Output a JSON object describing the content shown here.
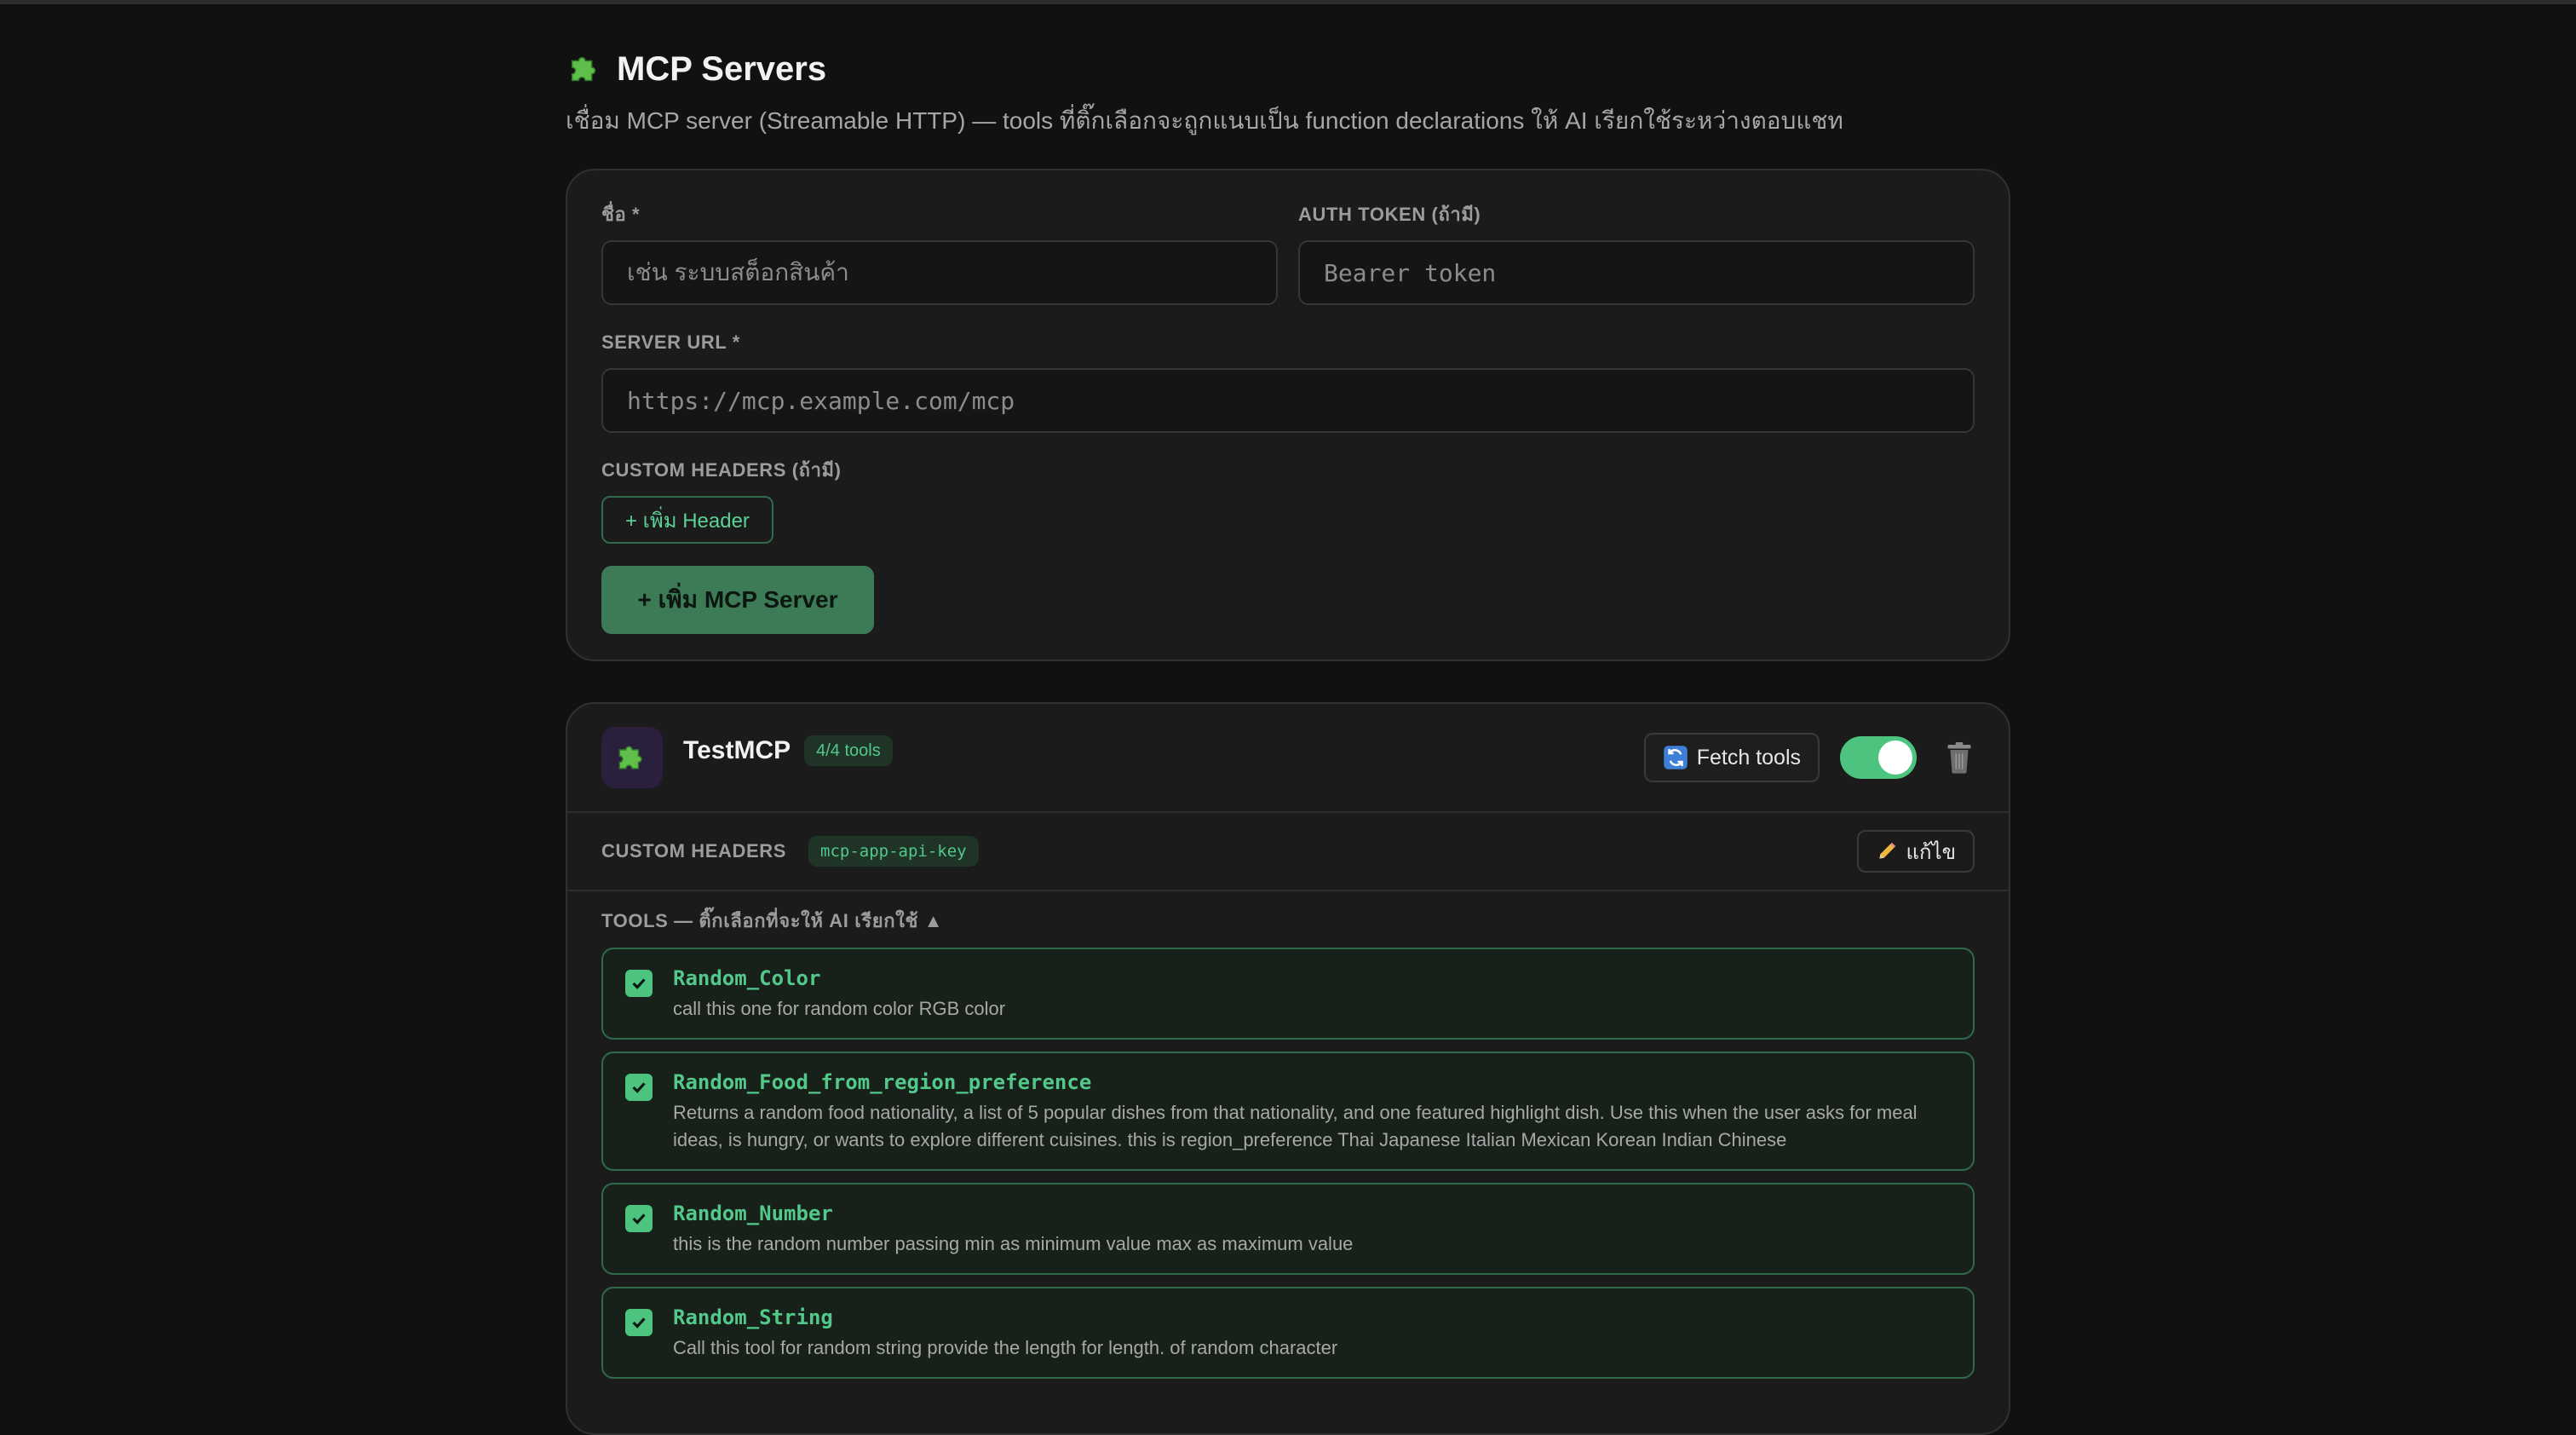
{
  "page": {
    "title": "MCP Servers",
    "subtitle": "เชื่อม MCP server (Streamable HTTP) — tools ที่ติ๊กเลือกจะถูกแนบเป็น function declarations ให้ AI เรียกใช้ระหว่างตอบแชท",
    "title_icon": "puzzle-icon"
  },
  "form": {
    "name_label": "ชื่อ *",
    "name_placeholder": "เช่น ระบบสต็อกสินค้า",
    "token_label": "AUTH TOKEN (ถ้ามี)",
    "token_placeholder": "Bearer token",
    "url_label": "SERVER URL *",
    "url_placeholder": "https://mcp.example.com/mcp",
    "headers_label": "CUSTOM HEADERS (ถ้ามี)",
    "add_header_label": "+ เพิ่ม Header",
    "add_server_label": "+ เพิ่ม MCP Server"
  },
  "server": {
    "name": "TestMCP",
    "tools_badge": "4/4 tools",
    "fetch_label": "Fetch tools",
    "enabled": true,
    "headers_label": "CUSTOM HEADERS",
    "header_chip": "mcp-app-api-key",
    "edit_label": "แก้ไข",
    "tools_label": "TOOLS — ติ๊กเลือกที่จะให้ AI เรียกใช้ ▲",
    "tools": [
      {
        "name": "Random_Color",
        "desc": "call this one for random color RGB color",
        "checked": true
      },
      {
        "name": "Random_Food_from_region_preference",
        "desc": "Returns a random food nationality, a list of 5 popular dishes from that nationality, and one featured highlight dish. Use this when the user asks for meal ideas, is hungry, or wants to explore different cuisines. this is region_preference Thai Japanese Italian Mexican Korean Indian Chinese",
        "checked": true
      },
      {
        "name": "Random_Number",
        "desc": "this is the random number passing min as minimum value max as maximum value",
        "checked": true
      },
      {
        "name": "Random_String",
        "desc": "Call this tool for random string provide the length for length. of random character",
        "checked": true
      }
    ]
  },
  "colors": {
    "accent": "#4cc47f",
    "accent_text": "#52c98a",
    "background": "#111111",
    "card": "#1b1b1b"
  }
}
